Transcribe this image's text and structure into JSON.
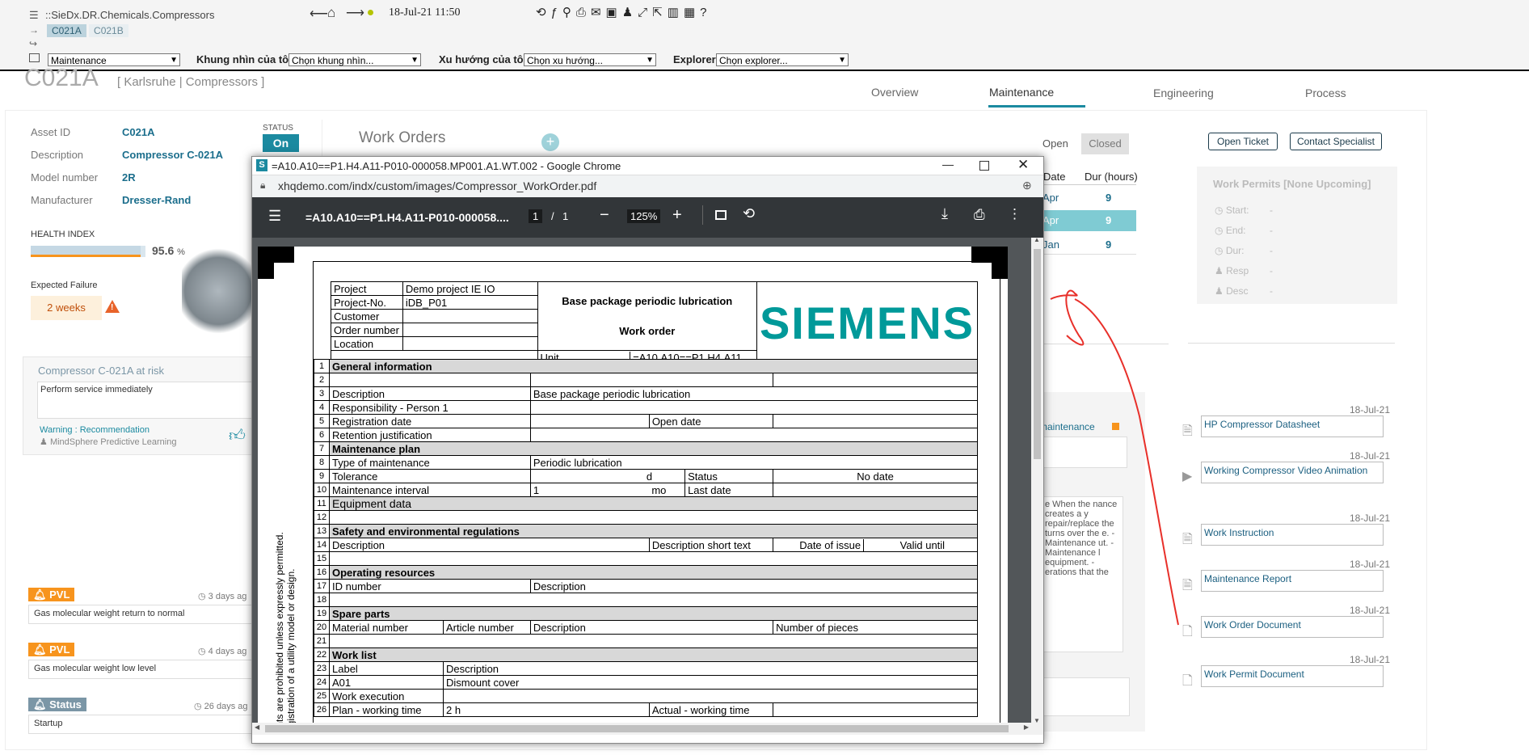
{
  "topbar": {
    "breadcrumb": "::SieDx.DR.Chemicals.Compressors",
    "chips": [
      "C021A",
      "C021B"
    ],
    "datetime": "18-Jul-21 11:50",
    "select_maintenance": "Maintenance",
    "view_label": "Khung nhìn của tôi",
    "view_select": "Chọn khung nhìn...",
    "trend_label": "Xu hướng của tôi",
    "trend_select": "Chọn xu hướng...",
    "explorer_label": "Explorer",
    "explorer_select": "Chọn explorer..."
  },
  "page": {
    "asset_title": "C021A",
    "asset_location": "[ Karlsruhe | Compressors ]",
    "tabs": [
      "Overview",
      "Maintenance",
      "Engineering",
      "Process"
    ],
    "active_tab": "Maintenance",
    "accent": "#1b8aa0"
  },
  "asset": {
    "id_label": "Asset ID",
    "id_value": "C021A",
    "desc_label": "Description",
    "desc_value": "Compressor C-021A",
    "model_label": "Model number",
    "model_value": "2R",
    "mfr_label": "Manufacturer",
    "mfr_value": "Dresser-Rand",
    "status_label": "STATUS",
    "status_value": "On",
    "health_label": "HEALTH INDEX",
    "health_value": "95.6",
    "health_unit": "%",
    "expected_failure_label": "Expected Failure",
    "expected_failure_value": "2 weeks"
  },
  "risk": {
    "title": "Compressor C-021A at risk",
    "message": "Perform service immediately",
    "warning": "Warning : Recommendation",
    "source": "MindSphere Predictive Learning"
  },
  "events": [
    {
      "badge": "PVL",
      "time": "3 days ag",
      "text": "Gas molecular weight return to normal",
      "color": "#f7941d"
    },
    {
      "badge": "PVL",
      "time": "4 days ag",
      "text": "Gas molecular weight low level",
      "color": "#f7941d"
    },
    {
      "badge": "Status",
      "time": "26 days ag",
      "text": "Startup",
      "color": "#7b96a6"
    }
  ],
  "work_orders": {
    "title": "Work Orders",
    "open": "Open",
    "closed": "Closed",
    "col_date": "Date",
    "col_dur": "Dur (hours)",
    "rows": [
      {
        "date": "Apr",
        "dur": "9"
      },
      {
        "date": "Apr",
        "dur": "9"
      },
      {
        "date": "Jan",
        "dur": "9"
      }
    ],
    "maintenance_tag": "d maintenance",
    "desc_text": "e When the nance creates a y repair/replace the turns over the e.  - Maintenance ut.  - Maintenance l equipment. - erations that the"
  },
  "actions": {
    "open_ticket": "Open Ticket",
    "contact": "Contact Specialist"
  },
  "permits": {
    "title": "Work Permits [None Upcoming]",
    "fields": [
      {
        "label": "Start:",
        "value": "-"
      },
      {
        "label": "End:",
        "value": "-"
      },
      {
        "label": "Dur:",
        "value": "-"
      },
      {
        "label": "Resp",
        "value": "-"
      },
      {
        "label": "Desc",
        "value": "-"
      }
    ]
  },
  "documents": [
    {
      "date": "18-Jul-21",
      "name": "HP Compressor Datasheet",
      "icon": "pdf-icon"
    },
    {
      "date": "18-Jul-21",
      "name": "Working Compressor Video Animation",
      "icon": "video-icon"
    },
    {
      "date": "18-Jul-21",
      "name": "Work Instruction",
      "icon": "pdf-icon"
    },
    {
      "date": "18-Jul-21",
      "name": "Maintenance Report",
      "icon": "pdf-icon"
    },
    {
      "date": "18-Jul-21",
      "name": "Work Order Document",
      "icon": "doc-icon"
    },
    {
      "date": "18-Jul-21",
      "name": "Work Permit Document",
      "icon": "doc-icon"
    }
  ],
  "chrome": {
    "title": "=A10.A10==P1.H4.A11-P010-000058.MP001.A1.WT.002 - Google Chrome",
    "url": "xhqdemo.com/indx/custom/images/Compressor_WorkOrder.pdf",
    "pdf_title": "=A10.A10==P1.H4.A11-P010-000058....",
    "page_current": "1",
    "page_sep": "/",
    "page_total": "1",
    "zoom": "125%"
  },
  "pdf": {
    "side_text_1": "contents are prohibited unless expressly permitted.",
    "side_text_2": "the registration of a utility model or design.",
    "logo": "SIEMENS",
    "header_title": "Base package periodic lubrication",
    "header_sub": "Work order",
    "project_label": "Project",
    "project_value": "Demo project IE IO",
    "projno_label": "Project-No.",
    "projno_value": "iDB_P01",
    "customer_label": "Customer",
    "order_label": "Order number",
    "location_label": "Location",
    "unit_label": "Unit",
    "unit_value": "=A10.A10==P1.H4.A11",
    "r1": "General information",
    "r3a": "Description",
    "r3b": "Base package periodic lubrication",
    "r4": "Responsibility - Person 1",
    "r5a": "Registration date",
    "r5b": "Open date",
    "r6": "Retention justification",
    "r7": "Maintenance plan",
    "r8a": "Type of maintenance",
    "r8b": "Periodic lubrication",
    "r9a": "Tolerance",
    "r9b": "d",
    "r9c": "Status",
    "r9d": "No date",
    "r10a": "Maintenance interval",
    "r10b": "1",
    "r10c": "mo",
    "r10d": "Last date",
    "r11": "Equipment data",
    "r13": "Safety and environmental regulations",
    "r14a": "Description",
    "r14b": "Description short text",
    "r14c": "Date of issue",
    "r14d": "Valid until",
    "r16": "Operating resources",
    "r17a": "ID number",
    "r17b": "Description",
    "r19": "Spare parts",
    "r20a": "Material number",
    "r20b": "Article number",
    "r20c": "Description",
    "r20d": "Number of pieces",
    "r22": "Work list",
    "r23a": "Label",
    "r23b": "Description",
    "r24a": "A01",
    "r24b": "Dismount cover",
    "r25": "Work execution",
    "r26a": "Plan - working time",
    "r26b": "2   h",
    "r26c": "Actual - working time"
  }
}
